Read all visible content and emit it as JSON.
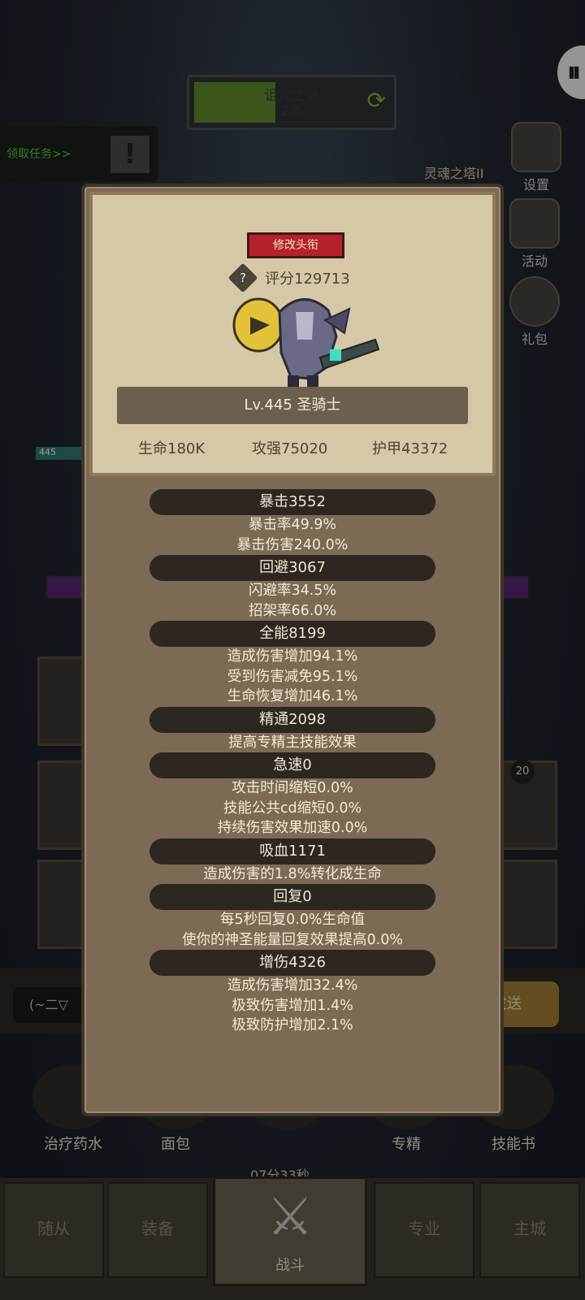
{
  "background": {
    "dungeon_title": "诅咒之渊",
    "dungeon_progress": "2/5",
    "task_label": "领取任务>>",
    "task_alert": "!",
    "tower_label": "灵魂之塔II",
    "side_buttons": [
      {
        "label": "设置",
        "icon": "gear-icon"
      },
      {
        "label": "活动",
        "icon": "calendar-icon"
      },
      {
        "label": "礼包",
        "icon": "chest-icon"
      }
    ],
    "hero_level": "445",
    "rank_badge": "20",
    "select_text": "(~二▽",
    "send_text": "发送",
    "consumables": [
      {
        "label": "治疗药水",
        "icon": "potion-icon"
      },
      {
        "label": "面包",
        "icon": "bread-icon"
      },
      {
        "label": "",
        "icon": "chest-icon"
      },
      {
        "label": "专精",
        "icon": "spec-icon"
      },
      {
        "label": "技能书",
        "icon": "book-icon"
      }
    ],
    "timer": "07分33秒",
    "nav_tabs": [
      "随从",
      "装备",
      "战斗",
      "专业",
      "主城"
    ]
  },
  "popup": {
    "title_button": "修改头衔",
    "score": "评分129713",
    "level_class": "Lv.445 圣骑士",
    "base_stats": {
      "hp": "生命180K",
      "attack": "攻强75020",
      "armor": "护甲43372"
    },
    "stat_groups": [
      {
        "header": "暴击3552",
        "lines": [
          "暴击率49.9%",
          "暴击伤害240.0%"
        ]
      },
      {
        "header": "回避3067",
        "lines": [
          "闪避率34.5%",
          "招架率66.0%"
        ]
      },
      {
        "header": "全能8199",
        "lines": [
          "造成伤害增加94.1%",
          "受到伤害减免95.1%",
          "生命恢复增加46.1%"
        ]
      },
      {
        "header": "精通2098",
        "lines": [
          "提高专精主技能效果"
        ]
      },
      {
        "header": "急速0",
        "lines": [
          "攻击时间缩短0.0%",
          "技能公共cd缩短0.0%",
          "持续伤害效果加速0.0%"
        ]
      },
      {
        "header": "吸血1171",
        "lines": [
          "造成伤害的1.8%转化成生命"
        ]
      },
      {
        "header": "回复0",
        "lines": [
          "每5秒回复0.0%生命值",
          "使你的神圣能量回复效果提高0.0%"
        ]
      },
      {
        "header": "增伤4326",
        "lines": [
          "造成伤害增加32.4%",
          "极致伤害增加1.4%",
          "极致防护增加2.1%"
        ]
      }
    ]
  },
  "colors": {
    "popup_body": "#7c6a55",
    "card": "#d6c8a6",
    "title_button": "#b5222a",
    "stat_header": "#2e2721"
  }
}
